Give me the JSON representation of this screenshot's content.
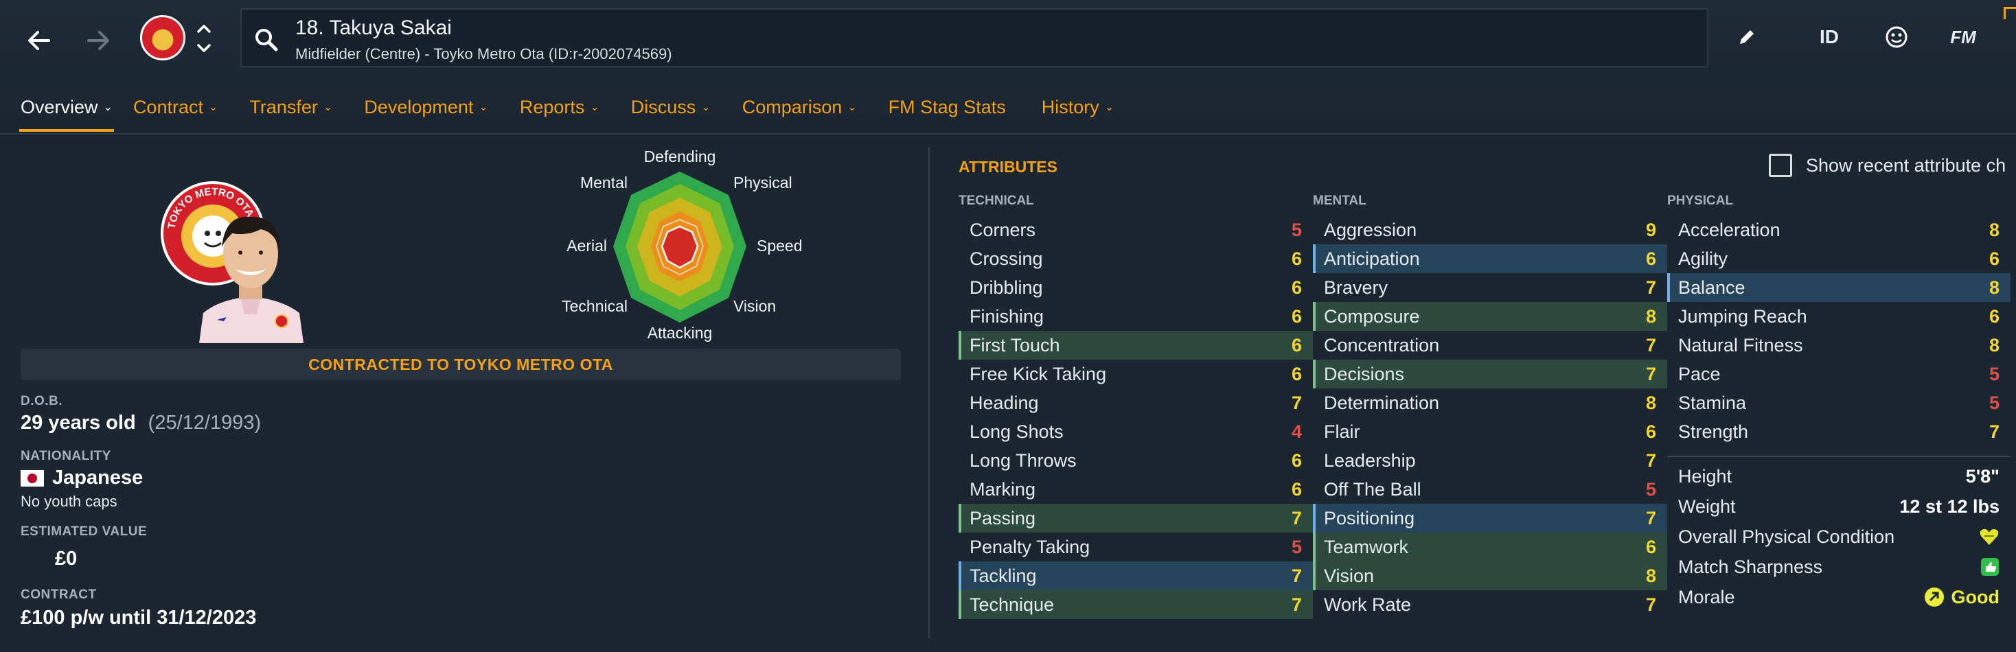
{
  "header": {
    "player_title": "18. Takuya Sakai",
    "player_subtitle": "Midfielder (Centre) - Toyko Metro Ota (ID:r-2002074569)",
    "tools": {
      "id_label": "ID",
      "fm_label": "FM"
    }
  },
  "tabs": [
    {
      "label": "Overview"
    },
    {
      "label": "Contract"
    },
    {
      "label": "Transfer"
    },
    {
      "label": "Development"
    },
    {
      "label": "Reports"
    },
    {
      "label": "Discuss"
    },
    {
      "label": "Comparison"
    },
    {
      "label": "FM Stag Stats"
    },
    {
      "label": "History"
    }
  ],
  "radar": {
    "labels": [
      "Defending",
      "Physical",
      "Speed",
      "Vision",
      "Attacking",
      "Technical",
      "Aerial",
      "Mental"
    ]
  },
  "badge_text": "TOKYO METRO OTA",
  "profile": {
    "contract_banner": "CONTRACTED TO TOYKO METRO OTA",
    "dob_label": "D.O.B.",
    "age": "29 years old",
    "dob": "(25/12/1993)",
    "nationality_label": "NATIONALITY",
    "nationality": "Japanese",
    "caps": "No youth caps",
    "value_label": "ESTIMATED VALUE",
    "value": "£0",
    "contract_label": "CONTRACT",
    "contract": "£100 p/w until 31/12/2023"
  },
  "attributes": {
    "heading": "ATTRIBUTES",
    "show_recent_label": "Show recent attribute ch",
    "technical": {
      "heading": "TECHNICAL",
      "rows": [
        {
          "name": "Corners",
          "value": "5"
        },
        {
          "name": "Crossing",
          "value": "6"
        },
        {
          "name": "Dribbling",
          "value": "6"
        },
        {
          "name": "Finishing",
          "value": "6"
        },
        {
          "name": "First Touch",
          "value": "6"
        },
        {
          "name": "Free Kick Taking",
          "value": "6"
        },
        {
          "name": "Heading",
          "value": "7"
        },
        {
          "name": "Long Shots",
          "value": "4"
        },
        {
          "name": "Long Throws",
          "value": "6"
        },
        {
          "name": "Marking",
          "value": "6"
        },
        {
          "name": "Passing",
          "value": "7"
        },
        {
          "name": "Penalty Taking",
          "value": "5"
        },
        {
          "name": "Tackling",
          "value": "7"
        },
        {
          "name": "Technique",
          "value": "7"
        }
      ]
    },
    "mental": {
      "heading": "MENTAL",
      "rows": [
        {
          "name": "Aggression",
          "value": "9"
        },
        {
          "name": "Anticipation",
          "value": "6"
        },
        {
          "name": "Bravery",
          "value": "7"
        },
        {
          "name": "Composure",
          "value": "8"
        },
        {
          "name": "Concentration",
          "value": "7"
        },
        {
          "name": "Decisions",
          "value": "7"
        },
        {
          "name": "Determination",
          "value": "8"
        },
        {
          "name": "Flair",
          "value": "6"
        },
        {
          "name": "Leadership",
          "value": "7"
        },
        {
          "name": "Off The Ball",
          "value": "5"
        },
        {
          "name": "Positioning",
          "value": "7"
        },
        {
          "name": "Teamwork",
          "value": "6"
        },
        {
          "name": "Vision",
          "value": "8"
        },
        {
          "name": "Work Rate",
          "value": "7"
        }
      ]
    },
    "physical": {
      "heading": "PHYSICAL",
      "rows": [
        {
          "name": "Acceleration",
          "value": "8"
        },
        {
          "name": "Agility",
          "value": "6"
        },
        {
          "name": "Balance",
          "value": "8"
        },
        {
          "name": "Jumping Reach",
          "value": "6"
        },
        {
          "name": "Natural Fitness",
          "value": "8"
        },
        {
          "name": "Pace",
          "value": "5"
        },
        {
          "name": "Stamina",
          "value": "5"
        },
        {
          "name": "Strength",
          "value": "7"
        }
      ],
      "extra": [
        {
          "name": "Height",
          "value": "5'8\""
        },
        {
          "name": "Weight",
          "value": "12 st 12 lbs"
        },
        {
          "name": "Overall Physical Condition",
          "value": ""
        },
        {
          "name": "Match Sharpness",
          "value": ""
        },
        {
          "name": "Morale",
          "value": "Good"
        }
      ]
    }
  },
  "colors": {
    "accent": "#f4a11a",
    "value_low": "#e0504a",
    "value_mid": "#f2d531",
    "value_high": "#f2d531"
  }
}
